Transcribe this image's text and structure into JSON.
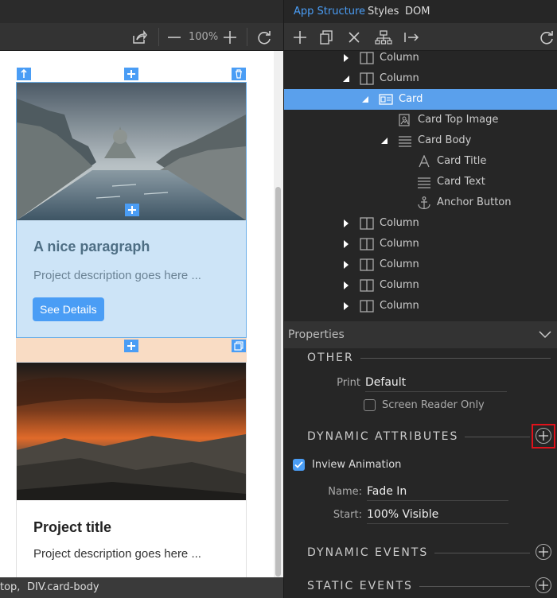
{
  "toolbar_left": {
    "zoom_label": "100%"
  },
  "canvas": {
    "card1": {
      "title": "A nice paragraph",
      "text": "Project description goes here ...",
      "button": "See Details"
    },
    "card2": {
      "title": "Project title",
      "text": "Project description goes here ..."
    }
  },
  "statusbar": {
    "crumb1": "top,",
    "crumb2": "DIV.card-body"
  },
  "tabs": [
    "App Structure",
    "Styles",
    "DOM"
  ],
  "tree": [
    {
      "label": "Column",
      "icon": "column-icon",
      "arrow": "collapsed"
    },
    {
      "label": "Column",
      "icon": "column-icon",
      "arrow": "expanded"
    },
    {
      "label": "Card",
      "icon": "card-icon",
      "arrow": "expanded",
      "selected": true
    },
    {
      "label": "Card Top Image",
      "icon": "image-icon",
      "arrow": "none"
    },
    {
      "label": "Card Body",
      "icon": "lines-icon",
      "arrow": "expanded"
    },
    {
      "label": "Card Title",
      "icon": "text-a-icon",
      "arrow": "none"
    },
    {
      "label": "Card Text",
      "icon": "lines-icon",
      "arrow": "none"
    },
    {
      "label": "Anchor Button",
      "icon": "anchor-icon",
      "arrow": "none"
    },
    {
      "label": "Column",
      "icon": "column-icon",
      "arrow": "collapsed"
    },
    {
      "label": "Column",
      "icon": "column-icon",
      "arrow": "collapsed"
    },
    {
      "label": "Column",
      "icon": "column-icon",
      "arrow": "collapsed"
    },
    {
      "label": "Column",
      "icon": "column-icon",
      "arrow": "collapsed"
    },
    {
      "label": "Column",
      "icon": "column-icon",
      "arrow": "collapsed"
    }
  ],
  "properties": {
    "header": "Properties",
    "other": {
      "title": "OTHER",
      "print_label": "Print",
      "print_value": "Default",
      "screen_reader_label": "Screen Reader Only",
      "screen_reader_checked": false
    },
    "dynamic_attributes": {
      "title": "DYNAMIC ATTRIBUTES",
      "inview_label": "Inview Animation",
      "inview_checked": true,
      "name_label": "Name:",
      "name_value": "Fade In",
      "start_label": "Start:",
      "start_value": "100% Visible"
    },
    "dynamic_events": {
      "title": "DYNAMIC EVENTS"
    },
    "static_events": {
      "title": "STATIC EVENTS"
    }
  },
  "colors": {
    "accent": "#4a9df5",
    "selection": "#5aa0ec",
    "highlight_box": "#e0121b"
  }
}
